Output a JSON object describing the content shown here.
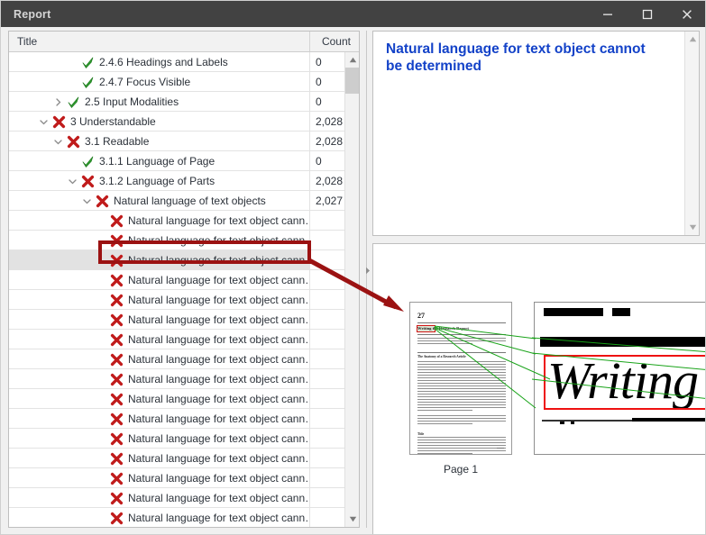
{
  "window": {
    "title": "Report",
    "controls": [
      {
        "name": "minimize",
        "label": "─"
      },
      {
        "name": "maximize",
        "label": "☐"
      },
      {
        "name": "close",
        "label": "✕"
      }
    ]
  },
  "tree": {
    "columns": {
      "title": "Title",
      "count": "Count"
    },
    "rows": [
      {
        "indent": 4,
        "twisty": "",
        "icon": "check",
        "label": "2.4.6 Headings and Labels",
        "count": "0"
      },
      {
        "indent": 4,
        "twisty": "",
        "icon": "check",
        "label": "2.4.7 Focus Visible",
        "count": "0"
      },
      {
        "indent": 3,
        "twisty": "collapsed",
        "icon": "check",
        "label": "2.5 Input Modalities",
        "count": "0"
      },
      {
        "indent": 2,
        "twisty": "expanded",
        "icon": "cross",
        "label": "3 Understandable",
        "count": "2,028"
      },
      {
        "indent": 3,
        "twisty": "expanded",
        "icon": "cross",
        "label": "3.1 Readable",
        "count": "2,028"
      },
      {
        "indent": 4,
        "twisty": "",
        "icon": "check",
        "label": "3.1.1 Language of Page",
        "count": "0"
      },
      {
        "indent": 4,
        "twisty": "expanded",
        "icon": "cross",
        "label": "3.1.2 Language of Parts",
        "count": "2,028"
      },
      {
        "indent": 5,
        "twisty": "expanded",
        "icon": "cross",
        "label": "Natural language of text objects",
        "count": "2,027"
      },
      {
        "indent": 6,
        "twisty": "",
        "icon": "cross",
        "label": "Natural language for text object cann…",
        "count": ""
      },
      {
        "indent": 6,
        "twisty": "",
        "icon": "cross",
        "label": "Natural language for text object cann…",
        "count": ""
      },
      {
        "indent": 6,
        "twisty": "",
        "icon": "cross",
        "label": "Natural language for text object cann…",
        "count": "",
        "selected": true
      },
      {
        "indent": 6,
        "twisty": "",
        "icon": "cross",
        "label": "Natural language for text object cann…",
        "count": ""
      },
      {
        "indent": 6,
        "twisty": "",
        "icon": "cross",
        "label": "Natural language for text object cann…",
        "count": ""
      },
      {
        "indent": 6,
        "twisty": "",
        "icon": "cross",
        "label": "Natural language for text object cann…",
        "count": ""
      },
      {
        "indent": 6,
        "twisty": "",
        "icon": "cross",
        "label": "Natural language for text object cann…",
        "count": ""
      },
      {
        "indent": 6,
        "twisty": "",
        "icon": "cross",
        "label": "Natural language for text object cann…",
        "count": ""
      },
      {
        "indent": 6,
        "twisty": "",
        "icon": "cross",
        "label": "Natural language for text object cann…",
        "count": ""
      },
      {
        "indent": 6,
        "twisty": "",
        "icon": "cross",
        "label": "Natural language for text object cann…",
        "count": ""
      },
      {
        "indent": 6,
        "twisty": "",
        "icon": "cross",
        "label": "Natural language for text object cann…",
        "count": ""
      },
      {
        "indent": 6,
        "twisty": "",
        "icon": "cross",
        "label": "Natural language for text object cann…",
        "count": ""
      },
      {
        "indent": 6,
        "twisty": "",
        "icon": "cross",
        "label": "Natural language for text object cann…",
        "count": ""
      },
      {
        "indent": 6,
        "twisty": "",
        "icon": "cross",
        "label": "Natural language for text object cann…",
        "count": ""
      },
      {
        "indent": 6,
        "twisty": "",
        "icon": "cross",
        "label": "Natural language for text object cann…",
        "count": ""
      },
      {
        "indent": 6,
        "twisty": "",
        "icon": "cross",
        "label": "Natural language for text object cann…",
        "count": ""
      }
    ]
  },
  "message": {
    "text": "Natural language for text object cannot be determined"
  },
  "preview": {
    "page_label": "Page 1",
    "thumbnail": {
      "page_number": "27",
      "heading": "Writing the Research Report",
      "highlighted_word": "Writing",
      "section_heading_1": "The Anatomy of a Research Article",
      "section_heading_2": "Title"
    },
    "detail": {
      "zoomed_word": "Writing"
    }
  },
  "colors": {
    "titlebar": "#424242",
    "message_text": "#1342c8",
    "annotation_red": "#9b1212",
    "highlight_red": "#ee1111",
    "connector_green": "#19a319",
    "status_pass": "#2f9e2f",
    "status_fail": "#c01b1b",
    "selection": "#e2e2e2"
  }
}
